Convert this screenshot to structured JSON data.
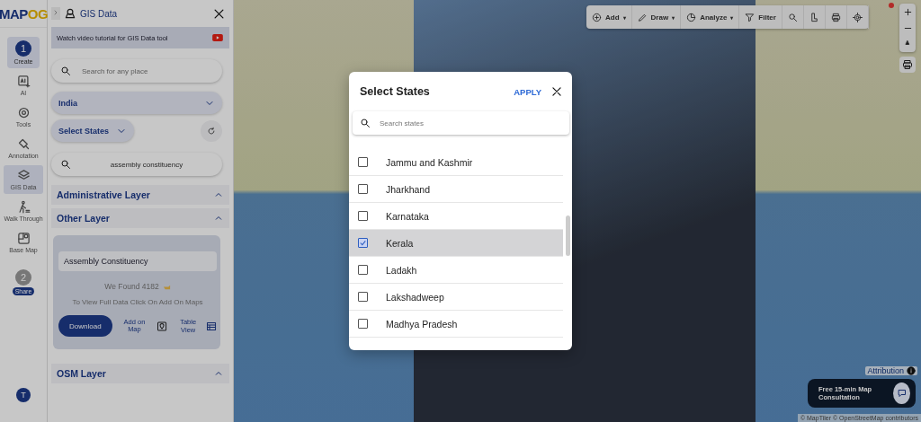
{
  "logo": "MAPOG",
  "panel": {
    "title": "GIS Data",
    "tutorial": "Watch video tutorial for GIS Data tool",
    "place_search": {
      "placeholder": "Search for any place"
    },
    "country": "India",
    "states_dropdown": "Select States",
    "layer_search": {
      "value": "assembly constituency"
    }
  },
  "rail": {
    "steps": [
      {
        "number": "1",
        "label": "Create"
      },
      {
        "number": "2",
        "label": "Share"
      }
    ],
    "items": [
      {
        "label": "AI",
        "selected": false
      },
      {
        "label": "Tools",
        "selected": false
      },
      {
        "label": "Annotation",
        "selected": false
      },
      {
        "label": "GIS Data",
        "selected": true
      },
      {
        "label": "Walk Through",
        "selected": false
      },
      {
        "label": "Base Map",
        "selected": false
      }
    ],
    "avatar": "T"
  },
  "sections": [
    {
      "title": "Administrative Layer",
      "expanded": true
    },
    {
      "title": "Other Layer",
      "expanded": true,
      "card": {
        "layer": "Assembly Constituency",
        "found": "We Found  4182",
        "hint": "To View Full Data Click On Add On Maps",
        "download": "Download",
        "add_on_map": "Add on Map",
        "table_view": "Table View"
      }
    },
    {
      "title": "OSM Layer",
      "expanded": true
    }
  ],
  "toolbar": [
    {
      "label": "Add",
      "caret": "▾"
    },
    {
      "label": "Draw",
      "caret": "▾"
    },
    {
      "label": "Analyze",
      "caret": "▾"
    },
    {
      "label": "Filter"
    }
  ],
  "map": {
    "attribution": "Attribution",
    "credits": "© MapTiler © OpenStreetMap contributors",
    "consultation": "Free 15-min Map Consultation"
  },
  "modal": {
    "title": "Select States",
    "apply": "APPLY",
    "search": {
      "placeholder": "Search states"
    },
    "states": [
      {
        "name": "Jammu and Kashmir",
        "checked": false,
        "selected": false
      },
      {
        "name": "Jharkhand",
        "checked": false,
        "selected": false
      },
      {
        "name": "Karnataka",
        "checked": false,
        "selected": false
      },
      {
        "name": "Kerala",
        "checked": true,
        "selected": true
      },
      {
        "name": "Ladakh",
        "checked": false,
        "selected": false
      },
      {
        "name": "Lakshadweep",
        "checked": false,
        "selected": false
      },
      {
        "name": "Madhya Pradesh",
        "checked": false,
        "selected": false
      }
    ]
  }
}
